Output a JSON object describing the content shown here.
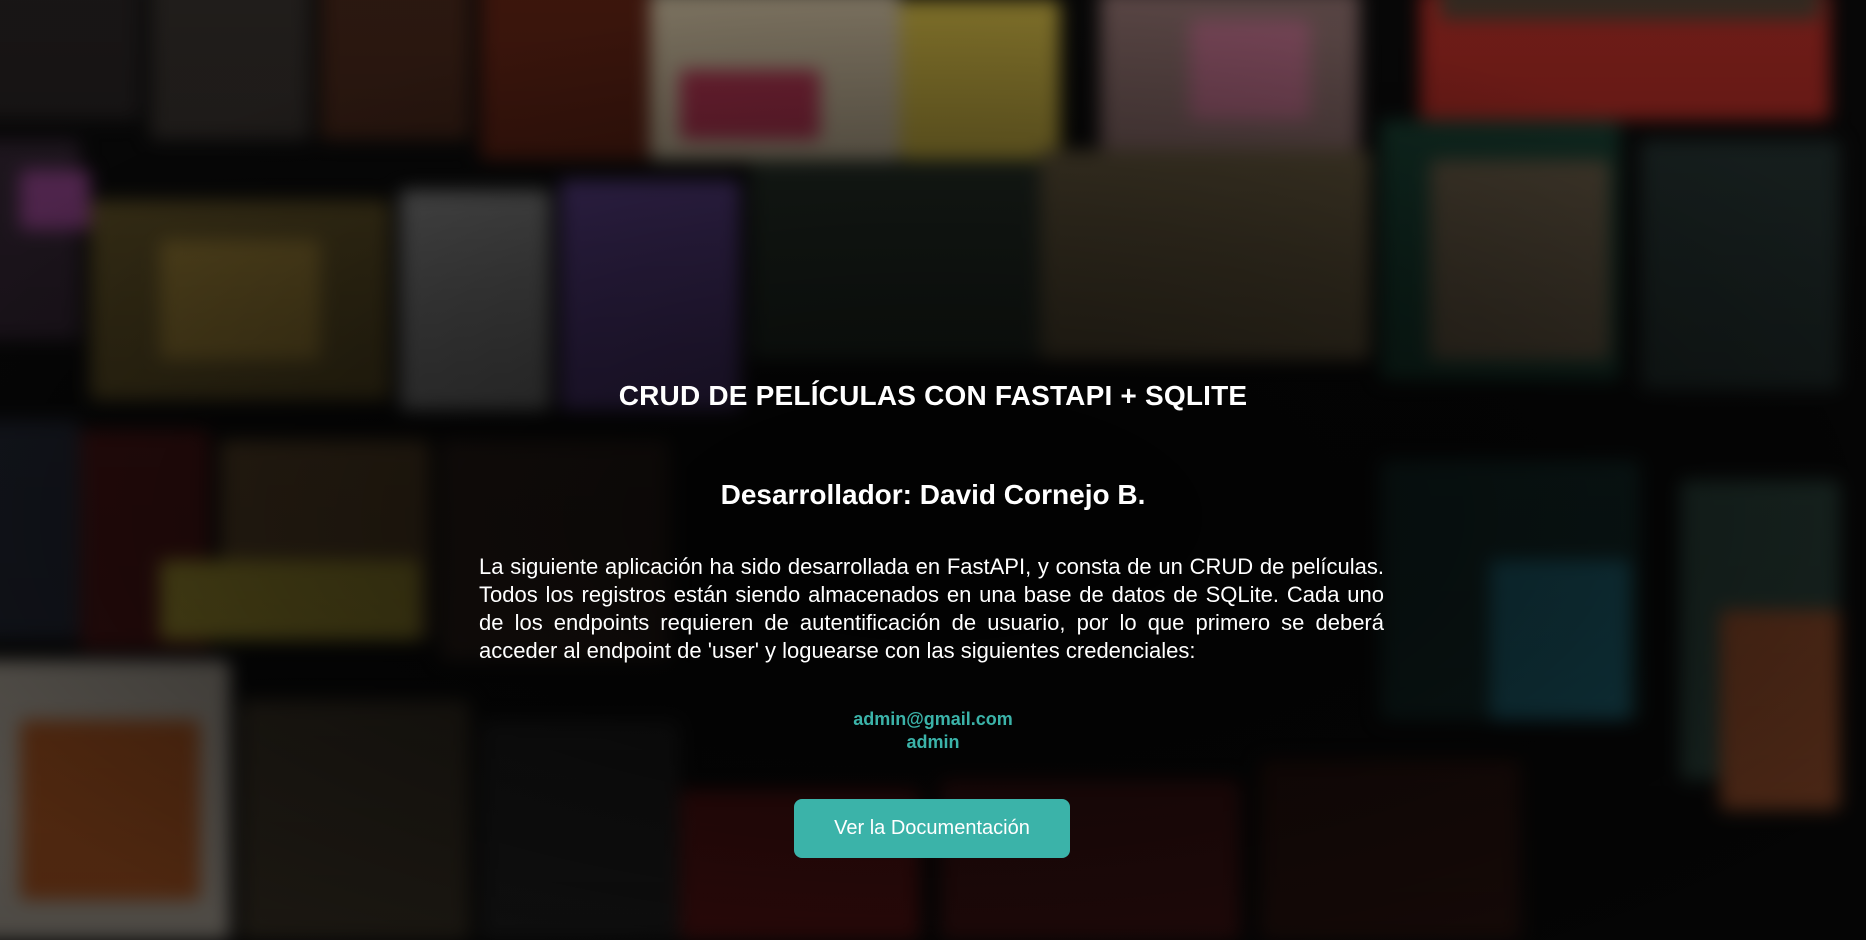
{
  "page": {
    "title": "CRUD DE PELÍCULAS CON FASTAPI + SQLITE",
    "developer": "Desarrollador: David Cornejo B.",
    "description": "La siguiente aplicación ha sido desarrollada en FastAPI, y consta de un CRUD de películas. Todos los registros están siendo almacenados en una base de datos de SQLite. Cada uno de los endpoints requieren de autentificación de usuario, por lo que primero se deberá acceder al endpoint de 'user' y loguearse con las siguientes credenciales:",
    "credentials": {
      "email": "admin@gmail.com",
      "password": "admin"
    },
    "doc_button_label": "Ver la Documentación"
  },
  "colors": {
    "accent": "#3bb3a9",
    "text": "#ffffff",
    "background_overlay": "#000000"
  }
}
